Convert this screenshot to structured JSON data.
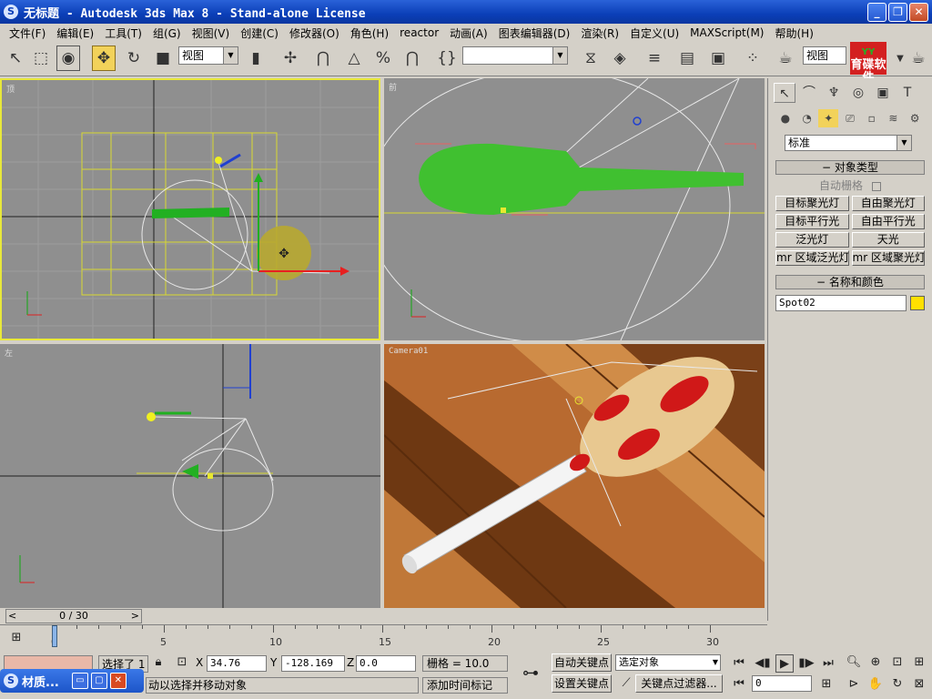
{
  "window": {
    "title": "无标题 - Autodesk 3ds Max 8 - Stand-alone License",
    "app_icon": "3ds-max-icon"
  },
  "menu": [
    "文件(F)",
    "编辑(E)",
    "工具(T)",
    "组(G)",
    "视图(V)",
    "创建(C)",
    "修改器(O)",
    "角色(H)",
    "reactor",
    "动画(A)",
    "图表编辑器(D)",
    "渲染(R)",
    "自定义(U)",
    "MAXScript(M)",
    "帮助(H)"
  ],
  "toolbar": {
    "ref_coord": "视图",
    "named_selection": "",
    "view_dropdown": "视图",
    "logo_top": "YY",
    "logo_bottom": "育碟软件"
  },
  "viewports": {
    "top_label": "顶",
    "front_label": "前",
    "left_label": "左",
    "camera_label": "Camera01"
  },
  "command_panel": {
    "category": "标准",
    "object_type_title": "对象类型",
    "auto_grid": "自动栅格",
    "buttons": [
      "目标聚光灯",
      "自由聚光灯",
      "目标平行光",
      "自由平行光",
      "泛光灯",
      "天光",
      "mr 区域泛光灯",
      "mr 区域聚光灯"
    ],
    "name_color_title": "名称和颜色",
    "object_name": "Spot02",
    "object_color": "#ffe000"
  },
  "timeline": {
    "frame_display": "0 / 30",
    "current_frame": 0,
    "total_frames": 30,
    "ticks": [
      "0",
      "5",
      "10",
      "15",
      "20",
      "25",
      "30"
    ]
  },
  "status": {
    "selected": "选择了 1",
    "x_label": "X",
    "x_value": "34.76",
    "y_label": "Y",
    "y_value": "-128.169",
    "z_label": "Z",
    "z_value": "0.0",
    "grid": "栅格 = 10.0",
    "prompt": "动以选择并移动对象",
    "add_time_tag": "添加时间标记",
    "auto_key": "自动关键点",
    "set_key": "设置关键点",
    "key_mode": "选定对象",
    "key_filters": "关键点过滤器...",
    "frame_field": "0"
  },
  "taskbar": {
    "label": "材质..."
  }
}
